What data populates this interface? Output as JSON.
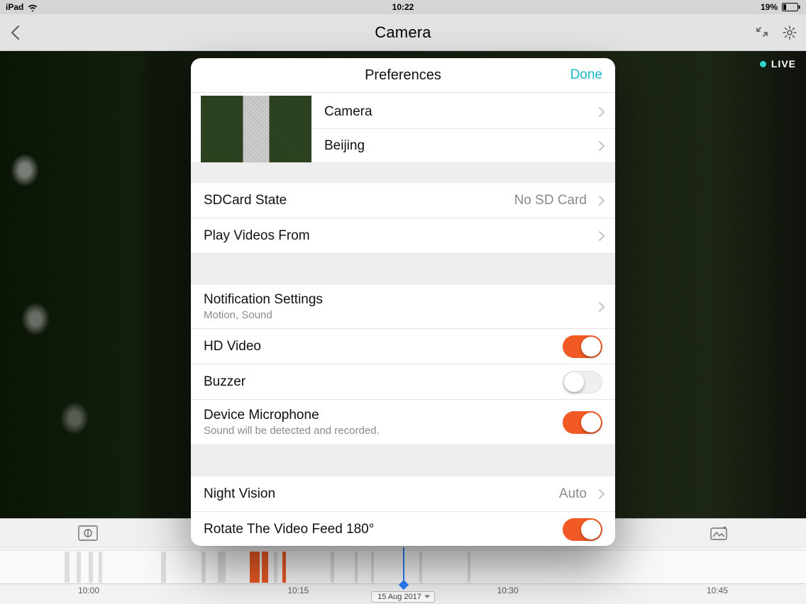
{
  "status": {
    "device": "iPad",
    "time": "10:22",
    "battery_pct": "19%"
  },
  "nav": {
    "title": "Camera"
  },
  "live": {
    "label": "LIVE"
  },
  "modal": {
    "title": "Preferences",
    "done": "Done",
    "camera": {
      "name_label": "Camera",
      "location_label": "Beijing"
    },
    "sdcard": {
      "label": "SDCard State",
      "value": "No SD Card"
    },
    "play_from": {
      "label": "Play Videos From"
    },
    "notifications": {
      "label": "Notification Settings",
      "sub": "Motion, Sound"
    },
    "hd_video": {
      "label": "HD Video",
      "on": true
    },
    "buzzer": {
      "label": "Buzzer",
      "on": false
    },
    "mic": {
      "label": "Device Microphone",
      "sub": "Sound will be detected and recorded.",
      "on": true
    },
    "night_vision": {
      "label": "Night Vision",
      "value": "Auto"
    },
    "rotate": {
      "label": "Rotate The Video Feed 180°",
      "on": true
    }
  },
  "timeline": {
    "date": "15 Aug 2017",
    "ticks": [
      "10:00",
      "10:15",
      "10:30",
      "10:45"
    ],
    "events": [
      {
        "pos": 8,
        "w": 0.6,
        "c": "g"
      },
      {
        "pos": 9.5,
        "w": 0.5,
        "c": "g"
      },
      {
        "pos": 11,
        "w": 0.5,
        "c": "g"
      },
      {
        "pos": 12.2,
        "w": 0.5,
        "c": "g"
      },
      {
        "pos": 20,
        "w": 0.6,
        "c": "g"
      },
      {
        "pos": 25,
        "w": 0.5,
        "c": "g"
      },
      {
        "pos": 27,
        "w": 1.0,
        "c": "g"
      },
      {
        "pos": 31,
        "w": 1.2,
        "c": "o"
      },
      {
        "pos": 32.5,
        "w": 0.8,
        "c": "o"
      },
      {
        "pos": 34,
        "w": 0.4,
        "c": "g"
      },
      {
        "pos": 35,
        "w": 0.5,
        "c": "o"
      },
      {
        "pos": 41,
        "w": 0.5,
        "c": "g"
      },
      {
        "pos": 44,
        "w": 0.4,
        "c": "g"
      },
      {
        "pos": 46,
        "w": 0.4,
        "c": "g"
      },
      {
        "pos": 52,
        "w": 0.4,
        "c": "g"
      },
      {
        "pos": 58,
        "w": 0.4,
        "c": "g"
      }
    ]
  }
}
